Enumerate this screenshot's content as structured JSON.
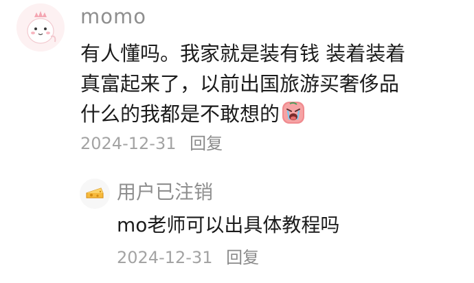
{
  "comment": {
    "author": "momo",
    "lines": [
      "有人懂吗。我家就是装有钱 装着装着",
      "真富起来了，以前出国旅游买奢侈品",
      "什么的我都是不敢想的"
    ],
    "emoji": "crying-face-sticker-icon",
    "date": "2024-12-31",
    "reply_label": "回复"
  },
  "reply": {
    "author": "用户已注销",
    "text": "mo老师可以出具体教程吗",
    "date": "2024-12-31",
    "reply_label": "回复"
  },
  "colors": {
    "meta_text": "#a3a3a3",
    "username": "#8e8e8e",
    "body_text": "#1b1b1b",
    "avatar_main_bg": "#fdf1f2",
    "avatar_main_accent": "#f4a6b2"
  }
}
